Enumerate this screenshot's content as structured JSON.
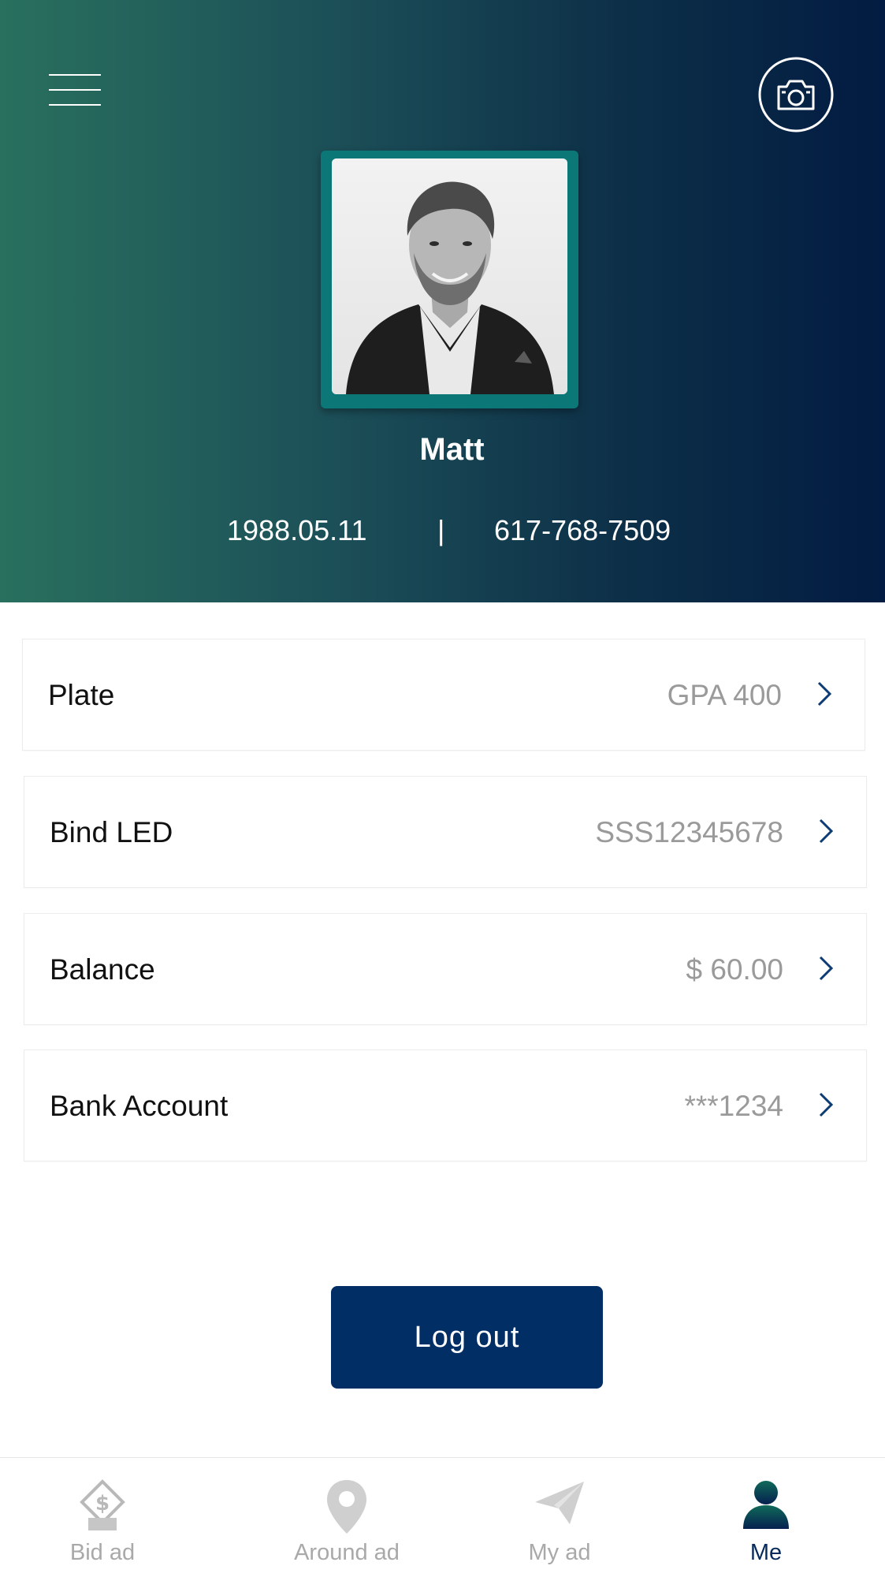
{
  "profile": {
    "name": "Matt",
    "birthdate": "1988.05.11",
    "separator": "|",
    "phone": "617-768-7509"
  },
  "rows": [
    {
      "label": "Plate",
      "value": "GPA 400"
    },
    {
      "label": "Bind LED",
      "value": "SSS12345678"
    },
    {
      "label": "Balance",
      "value": "$ 60.00"
    },
    {
      "label": "Bank Account",
      "value": "***1234"
    }
  ],
  "logout": {
    "label": "Log out"
  },
  "tabs": [
    {
      "label": "Bid ad",
      "icon": "bid-ad-icon",
      "active": false
    },
    {
      "label": "Around ad",
      "icon": "location-pin-icon",
      "active": false
    },
    {
      "label": "My ad",
      "icon": "paper-plane-icon",
      "active": false
    },
    {
      "label": "Me",
      "icon": "person-icon",
      "active": true
    }
  ],
  "colors": {
    "header_gradient_start": "#29705e",
    "header_gradient_end": "#021b42",
    "avatar_frame": "#0b7777",
    "primary_button": "#022e66",
    "tab_active": "#062a5c",
    "tab_inactive": "#a9a9a9",
    "row_value": "#9a9a9a"
  }
}
